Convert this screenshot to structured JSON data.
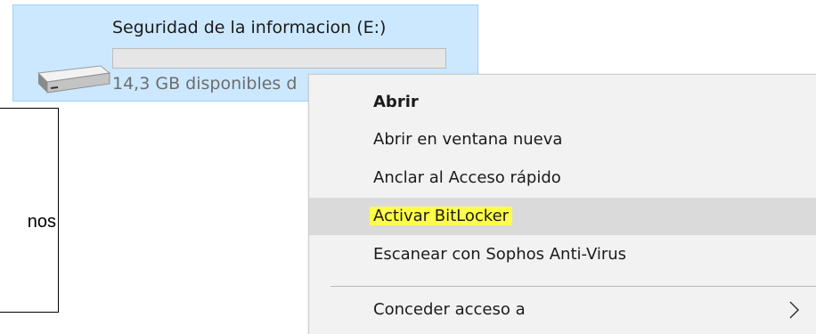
{
  "drive": {
    "name": "Seguridad de la informacion (E:)",
    "free_space": "14,3 GB disponibles d",
    "used_fraction": 0.0,
    "icon": "hard-drive-icon"
  },
  "callout": {
    "text": "nos"
  },
  "context_menu": {
    "items": [
      {
        "label": "Abrir"
      },
      {
        "label": "Abrir en ventana nueva"
      },
      {
        "label": "Anclar al Acceso rápido"
      },
      {
        "label": "Activar BitLocker"
      },
      {
        "label": "Escanear con Sophos Anti-Virus"
      },
      {
        "label": "Conceder acceso a"
      }
    ],
    "submenu_icon": "chevron-right-icon"
  },
  "colors": {
    "selection_bg": "#cce8ff",
    "menu_bg": "#f2f2f2",
    "hover_bg": "#dadada",
    "highlight": "#ffff47"
  }
}
